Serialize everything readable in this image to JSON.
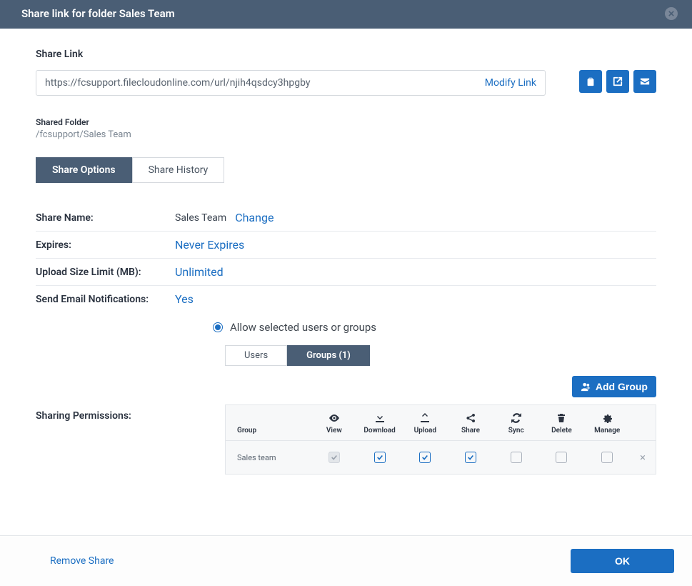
{
  "header": {
    "title": "Share link for folder Sales Team"
  },
  "share_link": {
    "label": "Share Link",
    "url": "https://fcsupport.filecloudonline.com/url/njih4qsdcy3hpgby",
    "modify": "Modify Link"
  },
  "shared_folder": {
    "label": "Shared Folder",
    "path": "/fcsupport/Sales Team"
  },
  "tabs": {
    "options": "Share Options",
    "history": "Share History"
  },
  "opts": {
    "name_label": "Share Name:",
    "name_value": "Sales Team",
    "change": "Change",
    "expires_label": "Expires:",
    "expires_value": "Never Expires",
    "upload_label": "Upload Size Limit (MB):",
    "upload_value": "Unlimited",
    "email_label": "Send Email Notifications:",
    "email_value": "Yes"
  },
  "radio": {
    "label": "Allow selected users or groups"
  },
  "subtabs": {
    "users": "Users",
    "groups": "Groups (1)"
  },
  "perm": {
    "label": "Sharing Permissions:",
    "add_group": "Add Group",
    "cols": {
      "group": "Group",
      "view": "View",
      "download": "Download",
      "upload": "Upload",
      "share": "Share",
      "sync": "Sync",
      "delete": "Delete",
      "manage": "Manage"
    },
    "rows": [
      {
        "name": "Sales team",
        "view": true,
        "view_disabled": true,
        "download": true,
        "upload": true,
        "share": true,
        "sync": false,
        "delete": false,
        "manage": false
      }
    ]
  },
  "footer": {
    "remove": "Remove Share",
    "ok": "OK"
  }
}
